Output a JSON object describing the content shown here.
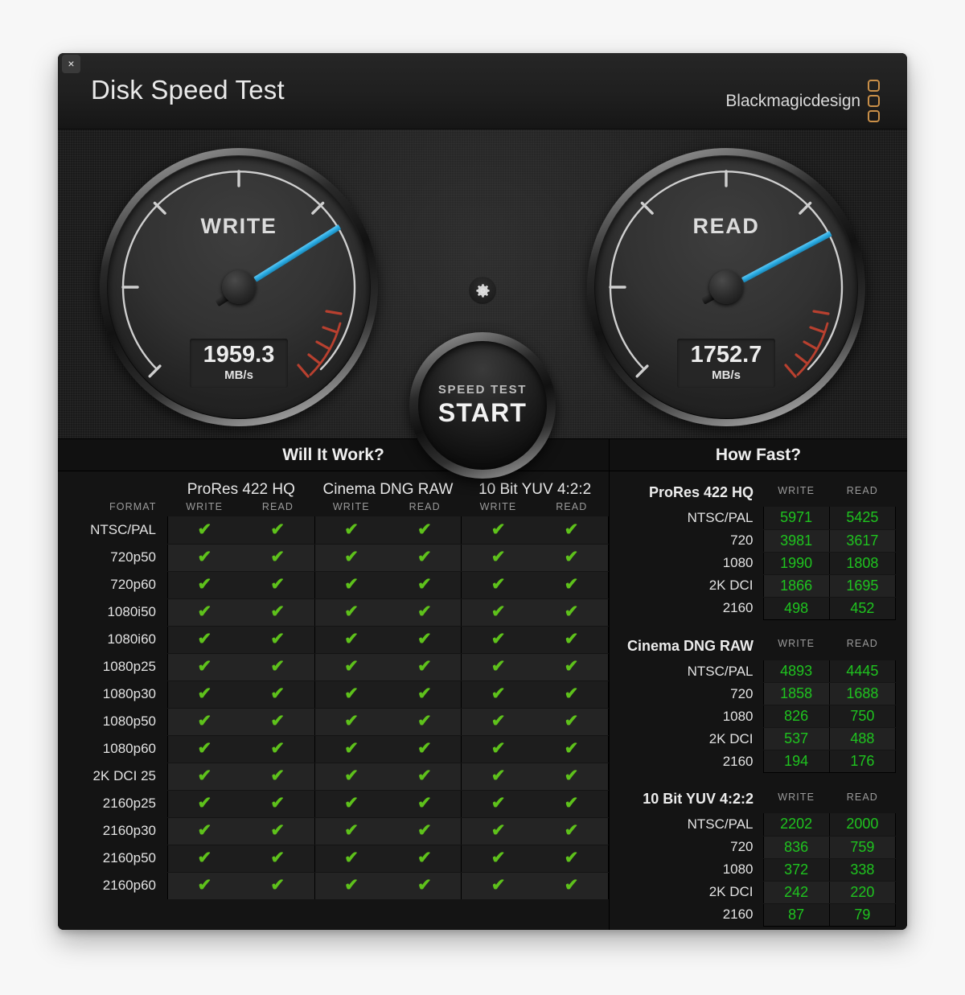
{
  "window": {
    "close_label": "×",
    "title": "Disk Speed Test",
    "brand": "Blackmagicdesign"
  },
  "gauges": {
    "write": {
      "label": "WRITE",
      "value": "1959.3",
      "unit": "MB/s",
      "needle_deg": -32
    },
    "read": {
      "label": "READ",
      "value": "1752.7",
      "unit": "MB/s",
      "needle_deg": -28
    }
  },
  "controls": {
    "gear_icon": "gear-icon",
    "start_kicker": "SPEED TEST",
    "start_label": "START"
  },
  "colors": {
    "needle": "#27a9e1",
    "check": "#5ec11b",
    "value_green": "#1fc41f",
    "brand_orange": "#c98f48",
    "red_zone": "#b8402f"
  },
  "will_it_work": {
    "title": "Will It Work?",
    "format_header": "FORMAT",
    "groups": [
      {
        "name": "ProRes 422 HQ",
        "columns": [
          "WRITE",
          "READ"
        ]
      },
      {
        "name": "Cinema DNG RAW",
        "columns": [
          "WRITE",
          "READ"
        ]
      },
      {
        "name": "10 Bit YUV 4:2:2",
        "columns": [
          "WRITE",
          "READ"
        ]
      }
    ],
    "check_glyph": "✔",
    "rows": [
      {
        "format": "NTSC/PAL",
        "cells": [
          true,
          true,
          true,
          true,
          true,
          true
        ]
      },
      {
        "format": "720p50",
        "cells": [
          true,
          true,
          true,
          true,
          true,
          true
        ]
      },
      {
        "format": "720p60",
        "cells": [
          true,
          true,
          true,
          true,
          true,
          true
        ]
      },
      {
        "format": "1080i50",
        "cells": [
          true,
          true,
          true,
          true,
          true,
          true
        ]
      },
      {
        "format": "1080i60",
        "cells": [
          true,
          true,
          true,
          true,
          true,
          true
        ]
      },
      {
        "format": "1080p25",
        "cells": [
          true,
          true,
          true,
          true,
          true,
          true
        ]
      },
      {
        "format": "1080p30",
        "cells": [
          true,
          true,
          true,
          true,
          true,
          true
        ]
      },
      {
        "format": "1080p50",
        "cells": [
          true,
          true,
          true,
          true,
          true,
          true
        ]
      },
      {
        "format": "1080p60",
        "cells": [
          true,
          true,
          true,
          true,
          true,
          true
        ]
      },
      {
        "format": "2K DCI 25",
        "cells": [
          true,
          true,
          true,
          true,
          true,
          true
        ]
      },
      {
        "format": "2160p25",
        "cells": [
          true,
          true,
          true,
          true,
          true,
          true
        ]
      },
      {
        "format": "2160p30",
        "cells": [
          true,
          true,
          true,
          true,
          true,
          true
        ]
      },
      {
        "format": "2160p50",
        "cells": [
          true,
          true,
          true,
          true,
          true,
          true
        ]
      },
      {
        "format": "2160p60",
        "cells": [
          true,
          true,
          true,
          true,
          true,
          true
        ]
      }
    ]
  },
  "how_fast": {
    "title": "How Fast?",
    "blocks": [
      {
        "name": "ProRes 422 HQ",
        "columns": [
          "WRITE",
          "READ"
        ],
        "rows": [
          {
            "label": "NTSC/PAL",
            "write": "5971",
            "read": "5425"
          },
          {
            "label": "720",
            "write": "3981",
            "read": "3617"
          },
          {
            "label": "1080",
            "write": "1990",
            "read": "1808"
          },
          {
            "label": "2K DCI",
            "write": "1866",
            "read": "1695"
          },
          {
            "label": "2160",
            "write": "498",
            "read": "452"
          }
        ]
      },
      {
        "name": "Cinema DNG RAW",
        "columns": [
          "WRITE",
          "READ"
        ],
        "rows": [
          {
            "label": "NTSC/PAL",
            "write": "4893",
            "read": "4445"
          },
          {
            "label": "720",
            "write": "1858",
            "read": "1688"
          },
          {
            "label": "1080",
            "write": "826",
            "read": "750"
          },
          {
            "label": "2K DCI",
            "write": "537",
            "read": "488"
          },
          {
            "label": "2160",
            "write": "194",
            "read": "176"
          }
        ]
      },
      {
        "name": "10 Bit YUV 4:2:2",
        "columns": [
          "WRITE",
          "READ"
        ],
        "rows": [
          {
            "label": "NTSC/PAL",
            "write": "2202",
            "read": "2000"
          },
          {
            "label": "720",
            "write": "836",
            "read": "759"
          },
          {
            "label": "1080",
            "write": "372",
            "read": "338"
          },
          {
            "label": "2K DCI",
            "write": "242",
            "read": "220"
          },
          {
            "label": "2160",
            "write": "87",
            "read": "79"
          }
        ]
      }
    ]
  }
}
